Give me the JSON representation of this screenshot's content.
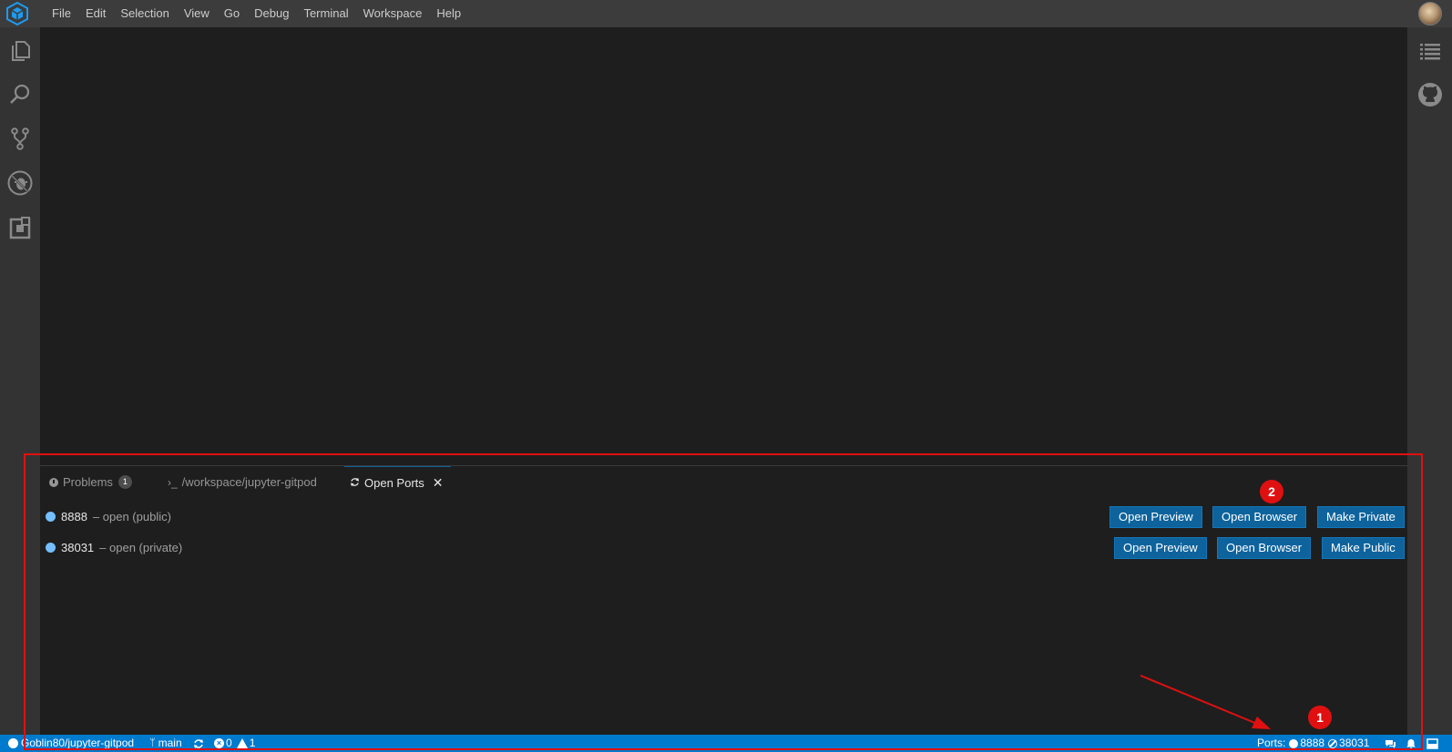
{
  "menu": {
    "items": [
      "File",
      "Edit",
      "Selection",
      "View",
      "Go",
      "Debug",
      "Terminal",
      "Workspace",
      "Help"
    ]
  },
  "activity": {
    "icons": [
      "files-icon",
      "search-icon",
      "source-control-icon",
      "debug-icon",
      "extensions-icon"
    ]
  },
  "right_bar": {
    "icons": [
      "outline-list-icon",
      "github-icon"
    ]
  },
  "panel": {
    "tabs": [
      {
        "label": "Problems",
        "badge": "1",
        "icon": "info-icon"
      },
      {
        "label": "/workspace/jupyter-gitpod",
        "icon": "terminal-icon"
      },
      {
        "label": "Open Ports",
        "icon": "sync-icon",
        "close": "✕"
      }
    ],
    "ports": [
      {
        "port": "8888",
        "status": "– open (public)",
        "buttons": [
          "Open Preview",
          "Open Browser",
          "Make Private"
        ]
      },
      {
        "port": "38031",
        "status": "– open (private)",
        "buttons": [
          "Open Preview",
          "Open Browser",
          "Make Public"
        ]
      }
    ]
  },
  "status": {
    "repo": "Goblin80/jupyter-gitpod",
    "branch": "main",
    "errors": "0",
    "warnings": "1",
    "ports_label": "Ports:",
    "port_public": "8888",
    "port_private": "38031"
  },
  "annotations": {
    "marker_1": "1",
    "marker_2": "2",
    "color": "#e01010"
  },
  "colors": {
    "accent": "#007acc",
    "button": "#0e639c",
    "port_dot": "#75beff"
  }
}
